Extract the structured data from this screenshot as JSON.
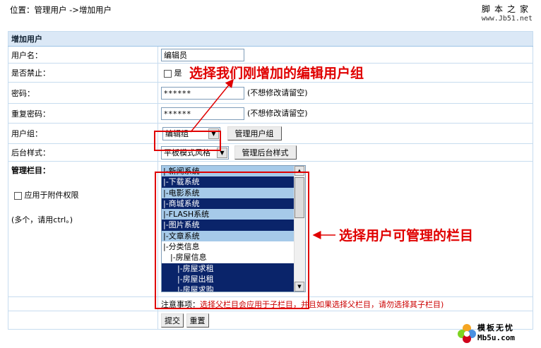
{
  "breadcrumb": {
    "prefix": "位置：",
    "link": "管理用户",
    "sep": " ->",
    "current": "增加用户"
  },
  "site": {
    "name": "脚本之家",
    "url": "www.Jb51.net"
  },
  "form": {
    "header": "增加用户",
    "username": {
      "label": "用户名：",
      "value": "编辑员"
    },
    "disabled": {
      "label": "是否禁止：",
      "option": "是"
    },
    "password": {
      "label": "密码：",
      "value": "******",
      "hint": "(不想修改请留空)"
    },
    "password2": {
      "label": "重复密码：",
      "value": "******",
      "hint": "(不想修改请留空)"
    },
    "group": {
      "label": "用户组：",
      "selected": "编辑组",
      "manage_btn": "管理用户组"
    },
    "style": {
      "label": "后台样式：",
      "selected": "平板模式风格",
      "manage_btn": "管理后台样式"
    },
    "columns": {
      "label": "管理栏目：",
      "attach_label": "应用于附件权限",
      "multi_hint": "(多个，请用ctrl。)",
      "items": [
        {
          "text": "|-新闻系统",
          "state": "l1"
        },
        {
          "text": "|-下载系统",
          "state": "sel1"
        },
        {
          "text": "|-电影系统",
          "state": "l1"
        },
        {
          "text": "|-商城系统",
          "state": "sel1"
        },
        {
          "text": "|-FLASH系统",
          "state": "l1"
        },
        {
          "text": "|-图片系统",
          "state": "sel1"
        },
        {
          "text": "|-文章系统",
          "state": "l1"
        },
        {
          "text": "|-分类信息",
          "state": "plain"
        },
        {
          "text": "|-房屋信息",
          "state": "plain ind1"
        },
        {
          "text": "|-房屋求租",
          "state": "dark ind2"
        },
        {
          "text": "|-房屋出租",
          "state": "dark ind2"
        },
        {
          "text": "|-房屋求购",
          "state": "dark ind2"
        }
      ]
    },
    "note": {
      "prefix": "注意事项：",
      "text": "选择父栏目会应用于子栏目，并且如果选择父栏目，请勿选择其子栏目)"
    },
    "submit": "提交",
    "reset": "重置"
  },
  "annotations": {
    "group_tip": "选择我们刚增加的编辑用户组",
    "columns_tip": "选择用户可管理的栏目"
  },
  "watermark": {
    "line1": "模板无忧",
    "line2": "Mb5u.com"
  },
  "colors": {
    "accent_red": "#e00000",
    "header_bg": "#dbe8f6",
    "list_selected": "#0a246a",
    "list_level1": "#a6cae9"
  }
}
